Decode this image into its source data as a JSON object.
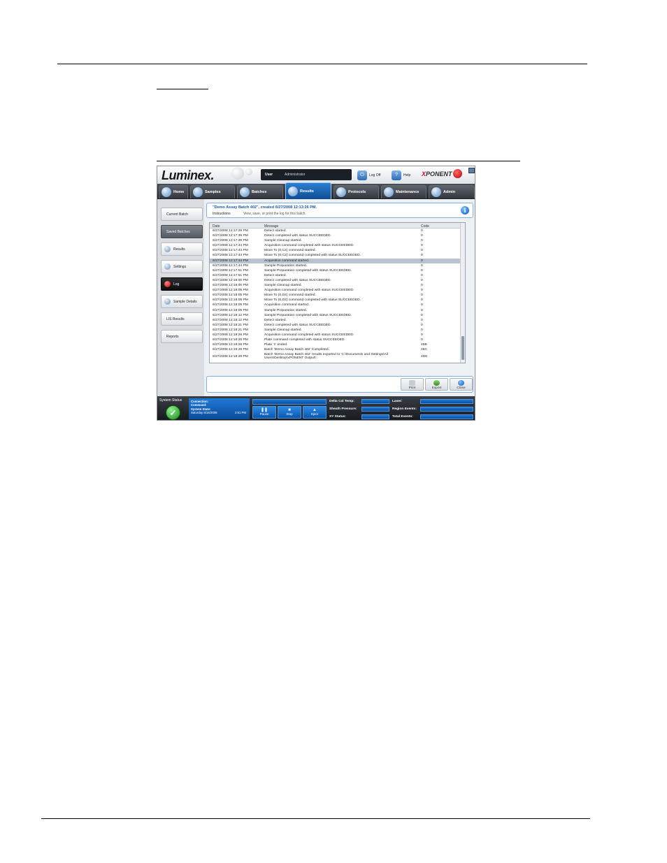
{
  "app": {
    "logo": "Luminex.",
    "user_label": "User",
    "user_value": "Administrator",
    "logoff_label": "Log Off",
    "help_label": "Help",
    "brand": "PONENT",
    "brand_x": "X"
  },
  "nav": {
    "tabs": [
      {
        "label": "Home"
      },
      {
        "label": "Samples"
      },
      {
        "label": "Batches"
      },
      {
        "label": "Results"
      },
      {
        "label": "Protocols"
      },
      {
        "label": "Maintenance"
      },
      {
        "label": "Admin"
      }
    ]
  },
  "sidebar": {
    "items": [
      {
        "label": "Current Batch"
      },
      {
        "label": "Saved Batches"
      },
      {
        "label": "Results"
      },
      {
        "label": "Settings"
      },
      {
        "label": "Log"
      },
      {
        "label": "Sample Details"
      },
      {
        "label": "LIS Results"
      },
      {
        "label": "Reports"
      }
    ]
  },
  "header": {
    "batch_title": "\"Demo Assay Batch 402\", created 6/27/2008 12:13:26 PM.",
    "instructions_label": "Instructions",
    "instructions_text": "View, save, or print the log for this batch."
  },
  "log": {
    "columns": [
      "Date",
      "Message",
      "Code"
    ],
    "rows": [
      {
        "date": "6/27/2008 12:17:29 PM",
        "message": "Detect started.",
        "code": "0"
      },
      {
        "date": "6/27/2008 12:17:39 PM",
        "message": "Detect completed with status SUCCEEDED.",
        "code": "0"
      },
      {
        "date": "6/27/2008 12:17:39 PM",
        "message": "Sample Cleanup started.",
        "code": "0"
      },
      {
        "date": "6/27/2008 12:17:44 PM",
        "message": "Acquisition command completed with status SUCCEEDED.",
        "code": "0"
      },
      {
        "date": "6/27/2008 12:17:44 PM",
        "message": "Move To (0,C2) command started.",
        "code": "0"
      },
      {
        "date": "6/27/2008 12:17:44 PM",
        "message": "Move To (0,C2) command completed with status SUCCEEDED.",
        "code": "0"
      },
      {
        "date": "6/27/2008 12:17:44 PM",
        "message": "Acquisition command started.",
        "code": "0"
      },
      {
        "date": "6/27/2008 12:17:44 PM",
        "message": "Sample Preparation started.",
        "code": "0"
      },
      {
        "date": "6/27/2008 12:17:51 PM",
        "message": "Sample Preparation completed with status SUCCEEDED.",
        "code": "0"
      },
      {
        "date": "6/27/2008 12:17:51 PM",
        "message": "Detect started.",
        "code": "0"
      },
      {
        "date": "6/27/2008 12:18:00 PM",
        "message": "Detect completed with status SUCCEEDED.",
        "code": "0"
      },
      {
        "date": "6/27/2008 12:18:00 PM",
        "message": "Sample Cleanup started.",
        "code": "0"
      },
      {
        "date": "6/27/2008 12:18:05 PM",
        "message": "Acquisition command completed with status SUCCEEDED.",
        "code": "0"
      },
      {
        "date": "6/27/2008 12:18:05 PM",
        "message": "Move To (0,D2) command started.",
        "code": "0"
      },
      {
        "date": "6/27/2008 12:18:05 PM",
        "message": "Move To (0,D2) command completed with status SUCCEEDED.",
        "code": "0"
      },
      {
        "date": "6/27/2008 12:18:05 PM",
        "message": "Acquisition command started.",
        "code": "0"
      },
      {
        "date": "6/27/2008 12:18:05 PM",
        "message": "Sample Preparation started.",
        "code": "0"
      },
      {
        "date": "6/27/2008 12:18:12 PM",
        "message": "Sample Preparation completed with status SUCCEEDED.",
        "code": "0"
      },
      {
        "date": "6/27/2008 12:18:12 PM",
        "message": "Detect started.",
        "code": "0"
      },
      {
        "date": "6/27/2008 12:18:21 PM",
        "message": "Detect completed with status SUCCEEDED.",
        "code": "0"
      },
      {
        "date": "6/27/2008 12:18:21 PM",
        "message": "Sample Cleanup started.",
        "code": "0"
      },
      {
        "date": "6/27/2008 12:18:26 PM",
        "message": "Acquisition command completed with status SUCCEEDED.",
        "code": "0"
      },
      {
        "date": "6/27/2008 12:18:26 PM",
        "message": "Plate command completed with status SUCCEEDED.",
        "code": "0"
      },
      {
        "date": "6/27/2008 12:18:26 PM",
        "message": "Plate '1' ended.",
        "code": "45B"
      },
      {
        "date": "6/27/2008 12:18:29 PM",
        "message": "Batch 'Demo Assay Batch 402' Completed.",
        "code": "45C"
      },
      {
        "date": "6/27/2008 12:18:29 PM",
        "message": "Batch 'Demo Assay Batch 402' results exported to 'C:\\Documents and Settings\\All",
        "message2": "Users\\Desktop\\xPONENT Output\\'.",
        "code": "4D6"
      }
    ],
    "highlighted_row": 6
  },
  "actions": {
    "print_label": "Print",
    "export_label": "Export",
    "close_label": "Close"
  },
  "status": {
    "system_status_label": "System Status",
    "connection_label": "Connection:",
    "command_label": "Command:",
    "system_state_label": "System State:",
    "datetime": "Saturday 8/16/2008",
    "time": "2:51 PM",
    "pause_label": "Pause",
    "stop_label": "Stop",
    "eject_label": "Eject",
    "delta_cal_temp_label": "Delta Cal Temp:",
    "sheath_pressure_label": "Sheath Pressure:",
    "xy_status_label": "XY Status:",
    "laser_label": "Laser:",
    "region_events_label": "Region Events:",
    "total_events_label": "Total Events:"
  }
}
